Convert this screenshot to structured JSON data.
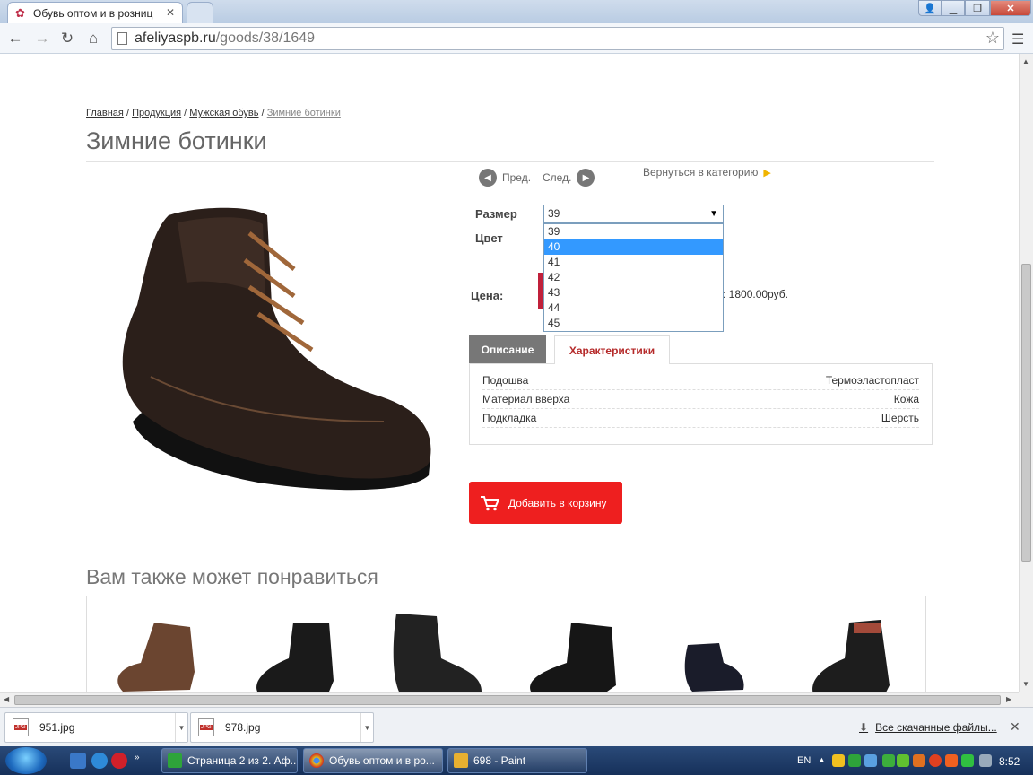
{
  "browser": {
    "tab_title": "Обувь оптом и в розниц",
    "url_host": "afeliyaspb.ru",
    "url_path": "/goods/38/1649"
  },
  "breadcrumb": {
    "home": "Главная",
    "sep": "/",
    "products": "Продукция",
    "mens": "Мужская обувь",
    "current": "Зимние ботинки"
  },
  "product": {
    "title": "Зимние ботинки",
    "prev_label": "Пред.",
    "next_label": "След.",
    "back_label": "Вернуться в категорию",
    "size_label": "Размер",
    "color_label": "Цвет",
    "price_label": "Цена:",
    "price_text": ": 1800.00руб.",
    "selected_size": "39",
    "size_options": [
      "39",
      "40",
      "41",
      "42",
      "43",
      "44",
      "45"
    ],
    "highlighted_option": "40",
    "tab_description": "Описание",
    "tab_specs": "Характеристики",
    "specs": [
      {
        "name": "Подошва",
        "value": "Термоэластопласт"
      },
      {
        "name": "Материал вверха",
        "value": "Кожа"
      },
      {
        "name": "Подкладка",
        "value": "Шерсть"
      }
    ],
    "add_to_cart": "Добавить в корзину"
  },
  "related": {
    "title": "Вам также может понравиться"
  },
  "downloads": {
    "items": [
      "951.jpg",
      "978.jpg"
    ],
    "all_label": "Все скачанные файлы..."
  },
  "taskbar": {
    "items": [
      "Страница 2 из 2. Аф...",
      "Обувь оптом и в ро...",
      "698 - Paint"
    ],
    "lang": "EN",
    "time": "8:52"
  },
  "colors": {
    "accent_red": "#ee1f1f",
    "tab_specs_text": "#b52a2a",
    "selection_blue": "#3399ff"
  }
}
